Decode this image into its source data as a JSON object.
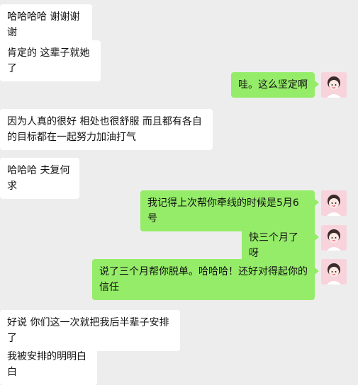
{
  "messages": [
    {
      "side": "in",
      "text": "哈哈哈哈 谢谢谢谢"
    },
    {
      "side": "in",
      "text": "肯定的 这辈子就她了"
    },
    {
      "side": "out",
      "text": "哇。这么坚定啊"
    },
    {
      "side": "in",
      "text": "因为人真的很好 相处也很舒服 而且都有各自的目标都在一起努力加油打气"
    },
    {
      "side": "in",
      "text": "哈哈哈 夫复何求"
    },
    {
      "side": "out",
      "text": "我记得上次帮你牵线的时候是5月6号"
    },
    {
      "side": "out",
      "text": "快三个月了呀"
    },
    {
      "side": "out",
      "text": "说了三个月帮你脱单。哈哈哈！还好对得起你的信任"
    },
    {
      "side": "in",
      "text": "好说 你们这一次就把我后半辈子安排了"
    },
    {
      "side": "in",
      "text": "我被安排的明明白白"
    }
  ],
  "colors": {
    "background": "#ededed",
    "incoming": "#ffffff",
    "outgoing": "#95ec69"
  },
  "avatar_icon": "girl-avatar-icon"
}
